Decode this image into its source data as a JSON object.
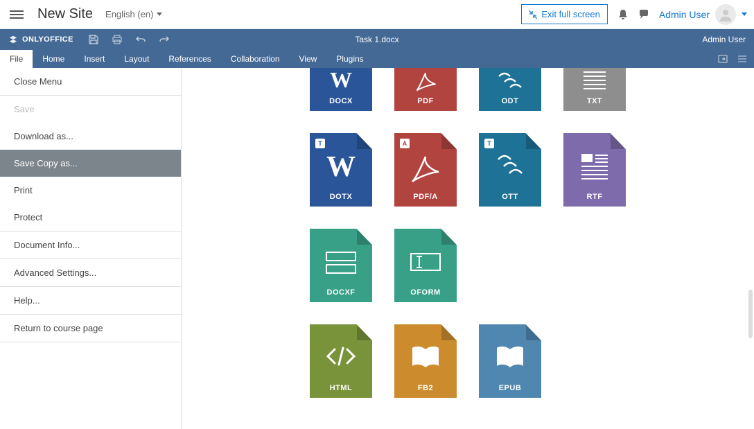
{
  "topbar": {
    "site_name": "New Site",
    "language": "English (en)",
    "exit_fullscreen": "Exit full screen",
    "user_name": "Admin User"
  },
  "oo": {
    "brand": "ONLYOFFICE",
    "doc_title": "Task 1.docx",
    "user": "Admin User",
    "tabs": [
      "File",
      "Home",
      "Insert",
      "Layout",
      "References",
      "Collaboration",
      "View",
      "Plugins"
    ],
    "active_tab": "File"
  },
  "file_menu": {
    "close": "Close Menu",
    "save": "Save",
    "download_as": "Download as...",
    "save_copy_as": "Save Copy as...",
    "print": "Print",
    "protect": "Protect",
    "document_info": "Document Info...",
    "advanced_settings": "Advanced Settings...",
    "help": "Help...",
    "return": "Return to course page"
  },
  "formats": {
    "row1": [
      {
        "key": "docx",
        "label": "DOCX",
        "color": "c-docx"
      },
      {
        "key": "pdf",
        "label": "PDF",
        "color": "c-pdf"
      },
      {
        "key": "odt",
        "label": "ODT",
        "color": "c-odt"
      },
      {
        "key": "txt",
        "label": "TXT",
        "color": "c-txt"
      }
    ],
    "row2": [
      {
        "key": "dotx",
        "label": "DOTX",
        "color": "c-dotx",
        "badge": "T"
      },
      {
        "key": "pdfa",
        "label": "PDF/A",
        "color": "c-pdfa",
        "badge": "A"
      },
      {
        "key": "ott",
        "label": "OTT",
        "color": "c-ott",
        "badge": "T"
      },
      {
        "key": "rtf",
        "label": "RTF",
        "color": "c-rtf"
      }
    ],
    "row3": [
      {
        "key": "docxf",
        "label": "DOCXF",
        "color": "c-docxf"
      },
      {
        "key": "oform",
        "label": "OFORM",
        "color": "c-oform"
      }
    ],
    "row4": [
      {
        "key": "html",
        "label": "HTML",
        "color": "c-html"
      },
      {
        "key": "fb2",
        "label": "FB2",
        "color": "c-fb2"
      },
      {
        "key": "epub",
        "label": "EPUB",
        "color": "c-epub"
      }
    ]
  }
}
